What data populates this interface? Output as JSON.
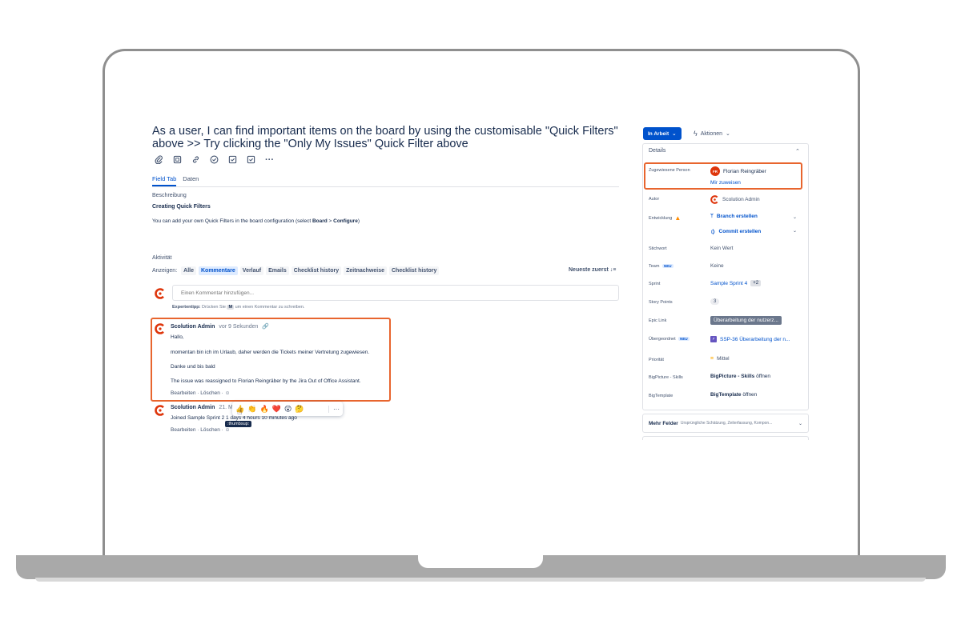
{
  "issue": {
    "title": "As a user, I can find important items on the board by using the customisable \"Quick Filters\" above >> Try clicking the \"Only My Issues\" Quick Filter above"
  },
  "toolbar": {
    "icons": [
      "paperclip-icon",
      "child-issue-icon",
      "link-icon",
      "checkmark-circle-icon",
      "checkbox-icon",
      "checkbox-icon",
      "more-icon"
    ]
  },
  "tabs": [
    {
      "label": "Field Tab"
    },
    {
      "label": "Daten"
    }
  ],
  "description": {
    "label": "Beschreibung",
    "heading": "Creating Quick Filters",
    "text_before": "You can add your own Quick Filters in the board configuration (select ",
    "board": "Board",
    "separator": " > ",
    "configure": "Configure",
    "text_after": ")"
  },
  "activity": {
    "label": "Aktivität",
    "show_label": "Anzeigen:",
    "filters": [
      "Alle",
      "Kommentare",
      "Verlauf",
      "Emails",
      "Checklist history",
      "Zeitnachweise",
      "Checklist history"
    ],
    "sort_label": "Neueste zuerst",
    "comment_placeholder": "Einen Kommentar hinzufügen...",
    "protip_bold": "Expertentipp:",
    "protip_text_1": "Drücken Sie",
    "protip_key": "M",
    "protip_text_2": "um einen Kommentar zu schreiben."
  },
  "comments": [
    {
      "author": "Scolution Admin",
      "time": "vor 9 Sekunden",
      "lines": [
        "Hallo,",
        "momentan bin ich im Urlaub, daher werden die Tickets meiner Vertretung zugewiesen.",
        "Danke und bis bald",
        "The issue was reassigned to Florian Reingräber by the Jira Out of Office Assistant."
      ],
      "edit": "Bearbeiten",
      "delete": "Löschen"
    },
    {
      "author": "Scolution Admin",
      "time": "21. M",
      "lines": [
        "Joined Sample Sprint 2 1 days 4 hours 10 minutes ago"
      ],
      "edit": "Bearbeiten",
      "delete": "Löschen"
    }
  ],
  "reactions": {
    "emojis": [
      "👍",
      "👏",
      "🔥",
      "❤️",
      "😲",
      "🤔"
    ],
    "more": "···",
    "tooltip": ":thumbsup:"
  },
  "sidebar": {
    "status": "In Arbeit",
    "actions": "Aktionen",
    "details_title": "Details",
    "fields": {
      "assignee": {
        "label": "Zugewiesene Person",
        "initials": "FR",
        "name": "Florian Reingräber",
        "assign_me": "Mir zuweisen"
      },
      "reporter": {
        "label": "Autor",
        "name": "Scolution Admin"
      },
      "development": {
        "label": "Entwicklung",
        "branch": "Branch erstellen",
        "commit": "Commit erstellen"
      },
      "labels": {
        "label": "Stichwort",
        "value": "Kein Wert"
      },
      "team": {
        "label": "Team",
        "badge": "NEU",
        "value": "Keine"
      },
      "sprint": {
        "label": "Sprint",
        "value": "Sample Sprint 4",
        "extra": "+2"
      },
      "story_points": {
        "label": "Story Points",
        "value": "3"
      },
      "epic_link": {
        "label": "Epic Link",
        "value": "Überarbeitung der nutzerz..."
      },
      "parent": {
        "label": "Übergeordnet",
        "badge": "NEU",
        "value": "SSP-36 Überarbeitung der n..."
      },
      "priority": {
        "label": "Priorität",
        "value": "Mittel"
      },
      "bigpicture": {
        "label": "BigPicture - Skills",
        "value_bold": "BigPicture - Skills",
        "value_rest": " öffnen"
      },
      "bigtemplate": {
        "label": "BigTemplate",
        "value_bold": "BigTemplate",
        "value_rest": " öffnen"
      }
    },
    "more_fields": {
      "label": "Mehr Felder",
      "sub": "Ursprüngliche Schätzung, Zeiterfassung, Kompon..."
    }
  },
  "colors": {
    "accent": "#0052cc",
    "highlight": "#e8652e",
    "scolution_logo": "#de350b"
  }
}
